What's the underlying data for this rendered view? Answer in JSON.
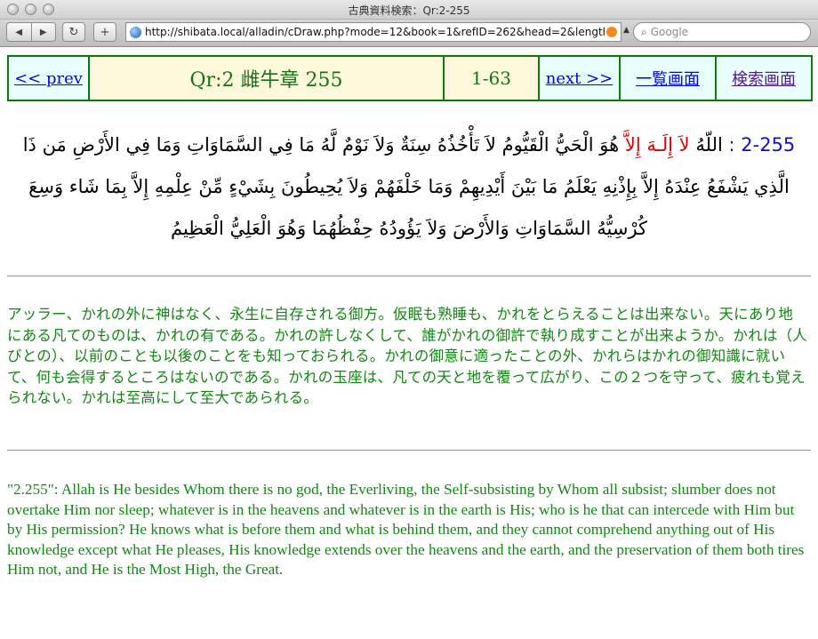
{
  "window": {
    "title": "古典資料検索：Qr:2-255"
  },
  "toolbar": {
    "back_icon": "◀",
    "forward_icon": "▶",
    "reload_icon": "↻",
    "add_icon": "+",
    "url": "http://shibata.local/alladin/cDraw.php?mode=12&book=1&refID=262&head=2&length=0",
    "search_placeholder": "Google",
    "search_icon": "⌕"
  },
  "nav": {
    "prev": "<< prev",
    "title": "Qr:2 雌牛章 255",
    "range": "1-63",
    "next": "next >>",
    "list": "一覧画面",
    "search": "検索画面"
  },
  "verse": {
    "ref": "2-255 :",
    "allah": "اللّهُ",
    "highlight": "لاَ إِلَـهَ إِلاَّ",
    "text": "هُوَ الْحَيُّ الْقَيُّومُ لاَ تَأْخُذُهُ سِنَةٌ وَلاَ نَوْمٌ لَّهُ مَا فِي السَّمَاوَاتِ وَمَا فِي الأَرْضِ مَن ذَا الَّذِي يَشْفَعُ عِنْدَهُ إِلاَّ بِإِذْنِهِ يَعْلَمُ مَا بَيْنَ أَيْدِيهِمْ وَمَا خَلْفَهُمْ وَلاَ يُحِيطُونَ بِشَيْءٍ مِّنْ عِلْمِهِ إِلاَّ بِمَا شَاء وَسِعَ كُرْسِيُّهُ السَّمَاوَاتِ وَالأَرْضَ وَلاَ يَؤُودُهُ حِفْظُهُمَا وَهُوَ الْعَلِيُّ الْعَظِيمُ"
  },
  "translation_ja": "アッラー、かれの外に神はなく、永生に自存される御方。仮眠も熟睡も、かれをとらえることは出来ない。天にあり地にある凡てのものは、かれの有である。かれの許しなくして、誰がかれの御許で執り成すことが出来ようか。かれは（人びとの）、以前のことも以後のことをも知っておられる。かれの御意に適ったことの外、かれらはかれの御知識に就いて、何も会得するところはないのである。かれの玉座は、凡ての天と地を覆って広がり、この２つを守って、疲れも覚えられない。かれは至高にして至大であられる。",
  "translation_en": "\"2.255\": Allah is He besides Whom there is no god, the Everliving, the Self-subsisting by Whom all subsist; slumber does not overtake Him nor sleep; whatever is in the heavens and whatever is in the earth is His; who is he that can intercede with Him but by His permission? He knows what is before them and what is behind them, and they cannot comprehend anything out of His knowledge except what He pleases, His knowledge extends over the heavens and the earth, and the preservation of them both tires Him not, and He is the Most High, the Great."
}
